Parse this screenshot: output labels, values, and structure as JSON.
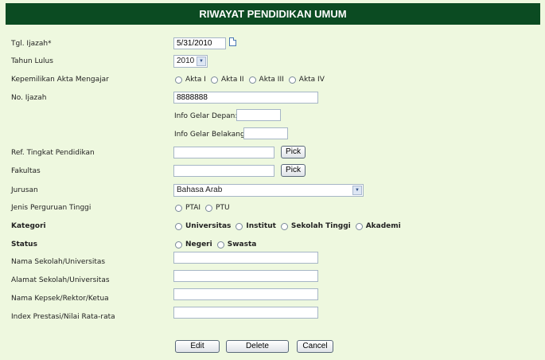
{
  "form": {
    "title": "RIWAYAT PENDIDIKAN UMUM",
    "fields": {
      "tgl_ijazah": {
        "label": "Tgl. Ijazah*",
        "value": "5/31/2010"
      },
      "tahun_lulus": {
        "label": "Tahun Lulus",
        "value": "2010"
      },
      "kepemilikan_akta": {
        "label": "Kepemilikan Akta Mengajar",
        "options": [
          "Akta I",
          "Akta II",
          "Akta III",
          "Akta IV"
        ]
      },
      "no_ijazah": {
        "label": "No. Ijazah",
        "value": "8888888"
      },
      "info_gelar_depan": {
        "label": "Info Gelar Depan:",
        "value": ""
      },
      "info_gelar_belakang": {
        "label": "Info Gelar Belakang:",
        "value": ""
      },
      "ref_tingkat": {
        "label": "Ref. Tingkat Pendidikan",
        "value": "",
        "button": "Pick"
      },
      "fakultas": {
        "label": "Fakultas",
        "value": "",
        "button": "Pick"
      },
      "jurusan": {
        "label": "Jurusan",
        "value": "Bahasa Arab"
      },
      "jenis_pt": {
        "label": "Jenis Perguruan Tinggi",
        "options": [
          "PTAI",
          "PTU"
        ]
      },
      "kategori": {
        "label": "Kategori",
        "options": [
          "Universitas",
          "Institut",
          "Sekolah Tinggi",
          "Akademi"
        ]
      },
      "status": {
        "label": "Status",
        "options": [
          "Negeri",
          "Swasta"
        ]
      },
      "nama_sekolah": {
        "label": "Nama Sekolah/Universitas",
        "value": ""
      },
      "alamat_sekolah": {
        "label": "Alamat Sekolah/Universitas",
        "value": ""
      },
      "nama_kepsek": {
        "label": "Nama Kepsek/Rektor/Ketua",
        "value": ""
      },
      "ipk": {
        "label": "Index Prestasi/Nilai Rata-rata",
        "value": ""
      }
    },
    "buttons": {
      "edit": "Edit",
      "delete": "Delete",
      "cancel": "Cancel"
    }
  },
  "colors": {
    "header_bg": "#0b4b22",
    "panel_bg": "#eef8df"
  }
}
